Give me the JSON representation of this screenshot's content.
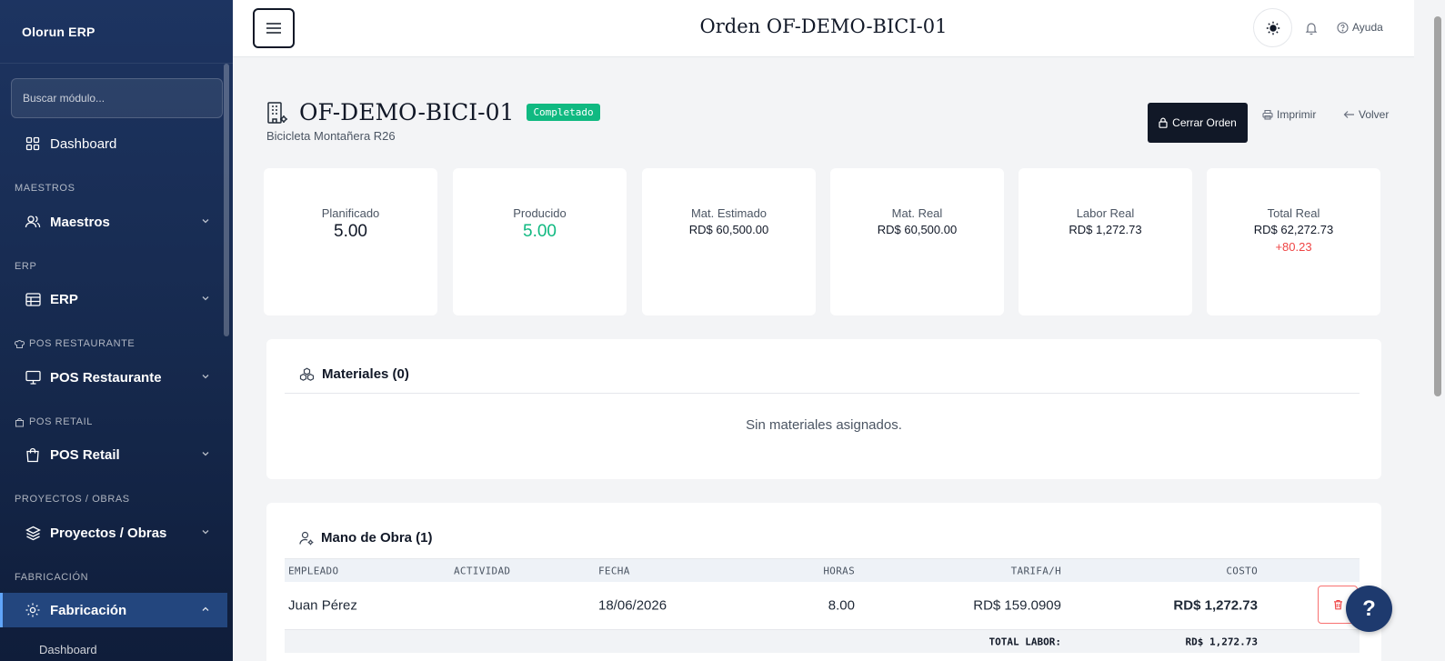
{
  "sidebar": {
    "brand": "Olorun ERP",
    "search_placeholder": "Buscar módulo...",
    "dashboard": "Dashboard",
    "sections": {
      "maestros": "MAESTROS",
      "erp": "ERP",
      "pos_restaurante": "POS RESTAURANTE",
      "pos_retail": "POS RETAIL",
      "proyectos": "PROYECTOS / OBRAS",
      "fabricacion": "FABRICACIÓN"
    },
    "items": {
      "maestros": "Maestros",
      "erp": "ERP",
      "pos_restaurante": "POS Restaurante",
      "pos_retail": "POS Retail",
      "proyectos": "Proyectos / Obras",
      "fabricacion": "Fabricación"
    },
    "sub_dashboard": "Dashboard"
  },
  "topbar": {
    "title": "Orden OF-DEMO-BICI-01",
    "help": "Ayuda"
  },
  "order": {
    "code": "OF-DEMO-BICI-01",
    "status": "Completado",
    "product": "Bicicleta Montañera R26",
    "close_button": "Cerrar Orden",
    "print": "Imprimir",
    "back": "Volver"
  },
  "stats": {
    "planned_label": "Planificado",
    "planned_value": "5.00",
    "produced_label": "Producido",
    "produced_value": "5.00",
    "mat_est_label": "Mat. Estimado",
    "mat_est_value": "RD$ 60,500.00",
    "mat_real_label": "Mat. Real",
    "mat_real_value": "RD$ 60,500.00",
    "labor_label": "Labor Real",
    "labor_value": "RD$ 1,272.73",
    "total_label": "Total Real",
    "total_value": "RD$ 62,272.73",
    "total_delta": "+80.23"
  },
  "materials": {
    "title": "Materiales (0)",
    "empty": "Sin materiales asignados."
  },
  "labor": {
    "title": "Mano de Obra (1)",
    "columns": {
      "employee": "EMPLEADO",
      "activity": "ACTIVIDAD",
      "date": "FECHA",
      "hours": "HORAS",
      "rate": "TARIFA/H",
      "cost": "COSTO"
    },
    "rows": [
      {
        "employee": "Juan Pérez",
        "activity": "",
        "date": "18/06/2026",
        "hours": "8.00",
        "rate": "RD$ 159.0909",
        "cost": "RD$ 1,272.73"
      }
    ],
    "total_label": "TOTAL LABOR:",
    "total_value": "RD$ 1,272.73"
  },
  "fab": "?",
  "colors": {
    "sidebar": "#1d3461",
    "accent_green": "#10b981",
    "danger": "#ef4444",
    "dark_button": "#111827"
  }
}
